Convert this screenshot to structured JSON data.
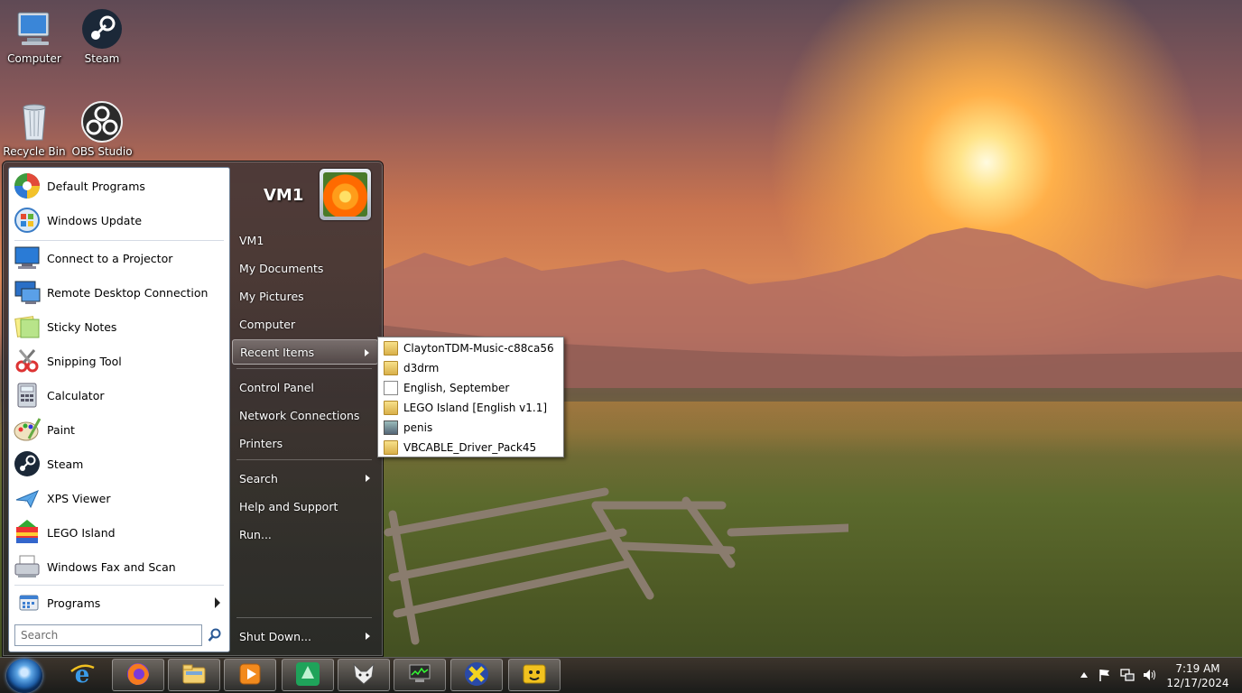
{
  "desktop": {
    "icons": [
      {
        "label": "Computer",
        "icon": "computer-icon"
      },
      {
        "label": "Steam",
        "icon": "steam-icon"
      },
      {
        "label": "Recycle Bin",
        "icon": "recycle-bin-icon"
      },
      {
        "label": "OBS Studio",
        "icon": "obs-icon"
      }
    ]
  },
  "start_menu": {
    "pinned": [
      {
        "label": "Default Programs",
        "icon": "default-programs-icon"
      },
      {
        "label": "Windows Update",
        "icon": "windows-update-icon"
      }
    ],
    "recent_programs": [
      {
        "label": "Connect to a Projector",
        "icon": "projector-icon"
      },
      {
        "label": "Remote Desktop Connection",
        "icon": "remote-desktop-icon"
      },
      {
        "label": "Sticky Notes",
        "icon": "sticky-notes-icon"
      },
      {
        "label": "Snipping Tool",
        "icon": "snipping-tool-icon"
      },
      {
        "label": "Calculator",
        "icon": "calculator-icon"
      },
      {
        "label": "Paint",
        "icon": "paint-icon"
      },
      {
        "label": "Steam",
        "icon": "steam-icon"
      },
      {
        "label": "XPS Viewer",
        "icon": "xps-viewer-icon"
      },
      {
        "label": "LEGO Island",
        "icon": "lego-island-icon"
      },
      {
        "label": "Windows Fax and Scan",
        "icon": "fax-scan-icon"
      }
    ],
    "programs_label": "Programs",
    "search_placeholder": "Search",
    "user_name": "VM1",
    "right_items": {
      "vm1": "VM1",
      "my_documents": "My Documents",
      "my_pictures": "My Pictures",
      "computer": "Computer",
      "recent_items": "Recent Items",
      "control_panel": "Control Panel",
      "network_connections": "Network Connections",
      "printers": "Printers",
      "search": "Search",
      "help_and_support": "Help and Support",
      "run": "Run...",
      "shut_down": "Shut Down..."
    }
  },
  "recent_items_flyout": [
    {
      "label": "ClaytonTDM-Music-c88ca56",
      "icon": "folder-icon"
    },
    {
      "label": "d3drm",
      "icon": "folder-icon"
    },
    {
      "label": "English, September",
      "icon": "document-icon"
    },
    {
      "label": "LEGO Island [English v1.1]",
      "icon": "folder-icon"
    },
    {
      "label": "penis",
      "icon": "image-file-icon"
    },
    {
      "label": "VBCABLE_Driver_Pack45",
      "icon": "folder-icon"
    }
  ],
  "taskbar": {
    "clock_time": "7:19 AM",
    "clock_date": "12/17/2024",
    "apps": [
      {
        "name": "internet-explorer",
        "icon": "internet-explorer-icon"
      },
      {
        "name": "firefox",
        "icon": "firefox-icon",
        "open": true
      },
      {
        "name": "file-explorer",
        "icon": "file-explorer-icon",
        "open": true
      },
      {
        "name": "media-player",
        "icon": "media-player-icon",
        "open": true
      },
      {
        "name": "app-green",
        "icon": "green-app-icon",
        "open": true
      },
      {
        "name": "app-fox",
        "icon": "fox-app-icon",
        "open": true
      },
      {
        "name": "task-manager",
        "icon": "computer-monitor-icon",
        "open": true
      },
      {
        "name": "app-x",
        "icon": "x-app-icon",
        "open": true
      },
      {
        "name": "app-yellow",
        "icon": "yellow-app-icon",
        "open": true
      }
    ]
  },
  "colors": {
    "start_menu_bg": "#3c3434",
    "left_pane_bg": "#ffffff",
    "flyout_bg": "#ffffff",
    "taskbar_bg": "#2a2624"
  }
}
